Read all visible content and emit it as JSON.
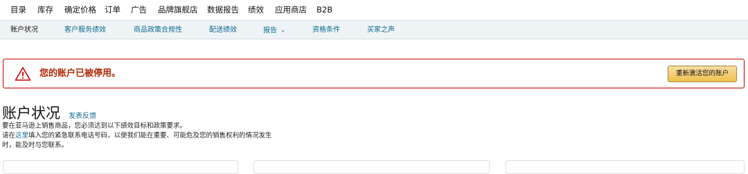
{
  "top_nav": {
    "items": [
      "目录",
      "库存",
      "确定价格",
      "订单",
      "广告",
      "品牌旗舰店",
      "数据报告",
      "绩效",
      "应用商店",
      "B2B"
    ]
  },
  "sub_nav": {
    "items": [
      "账户状况",
      "客户服务绩效",
      "商品政策合规性",
      "配送绩效",
      "报告",
      "资格条件",
      "买家之声"
    ],
    "active_index": 0,
    "dropdown_item": "报告"
  },
  "alert": {
    "icon": "warning-triangle-icon",
    "message": "您的账户已被停用。",
    "button_label": "重新激活您的账户",
    "colors": {
      "border": "#c40000",
      "text": "#b12704",
      "button": "#f0c14b"
    }
  },
  "page": {
    "title": "账户状况",
    "feedback_link": "发表反馈",
    "description_line1": "要在亚马逊上销售商品，您必须达到以下绩效目标和政策要求。",
    "description_line2_prefix": "请在",
    "description_line2_link": "这里",
    "description_line2_suffix": "填入您的紧急联系电话号码，以便我们能在重要、可能危及您的销售权利的情况发生",
    "description_line3": "时，能及时与您联系。"
  },
  "colors": {
    "link": "#0f6b8f",
    "sub_nav_bg": "#eef3f6"
  }
}
